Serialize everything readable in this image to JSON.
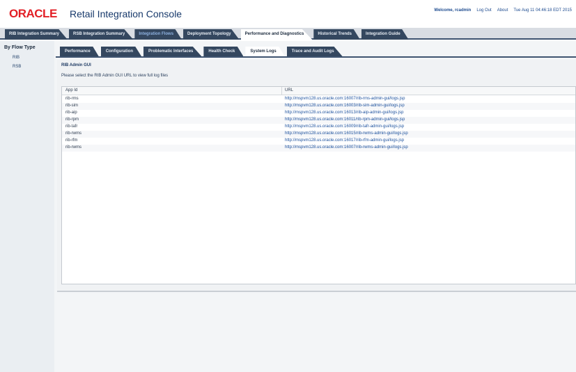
{
  "header": {
    "logo": "ORACLE",
    "title": "Retail Integration Console",
    "welcome": "Welcome, rcadmin",
    "links": [
      "Log Out",
      "About"
    ],
    "datetime": "Tue Aug 11 04:46:18 EDT 2015"
  },
  "main_tabs": [
    {
      "label": "RIB Integration Summary"
    },
    {
      "label": "RSB Integration Summary"
    },
    {
      "label": "Integration Flows"
    },
    {
      "label": "Deployment Topology"
    },
    {
      "label": "Performance and Diagnostics"
    },
    {
      "label": "Historical Trends"
    },
    {
      "label": "Integration Guide"
    }
  ],
  "leftnav": {
    "title": "By Flow Type",
    "items": [
      "RIB",
      "RSB"
    ]
  },
  "sub_tabs": [
    {
      "label": "Performance"
    },
    {
      "label": "Configuration"
    },
    {
      "label": "Problematic Interfaces"
    },
    {
      "label": "Health Check"
    },
    {
      "label": "System Logs"
    },
    {
      "label": "Trace and Audit Logs"
    }
  ],
  "panel": {
    "title": "RIB Admin GUI",
    "hint": "Please select the RIB Admin GUI URL to view full log files",
    "columns": {
      "app_id": "App Id",
      "url": "URL"
    },
    "rows": [
      {
        "app_id": "rib-rms",
        "url": "http://mspvm128.us.oracle.com:16007/rib-rms-admin-gui/logs.jsp"
      },
      {
        "app_id": "rib-sim",
        "url": "http://mspvm128.us.oracle.com:16003/rib-sim-admin-gui/logs.jsp"
      },
      {
        "app_id": "rib-aip",
        "url": "http://mspvm128.us.oracle.com:16013/rib-aip-admin-gui/logs.jsp"
      },
      {
        "app_id": "rib-rpm",
        "url": "http://mspvm128.us.oracle.com:16011/rib-rpm-admin-gui/logs.jsp"
      },
      {
        "app_id": "rib-tafr",
        "url": "http://mspvm128.us.oracle.com:16009/rib-tafr-admin-gui/logs.jsp"
      },
      {
        "app_id": "rib-rwms",
        "url": "http://mspvm128.us.oracle.com:16015/rib-rwms-admin-gui/logs.jsp"
      },
      {
        "app_id": "rib-rfm",
        "url": "http://mspvm128.us.oracle.com:16017/rib-rfm-admin-gui/logs.jsp"
      },
      {
        "app_id": "rib-rwms",
        "url": "http://mspvm128.us.oracle.com:16007/rib-rwms-admin-gui/logs.jsp"
      }
    ]
  },
  "colors": {
    "tab_bg": "#34475f",
    "logo_red": "#e21f26",
    "link_blue": "#1a4f9c"
  }
}
